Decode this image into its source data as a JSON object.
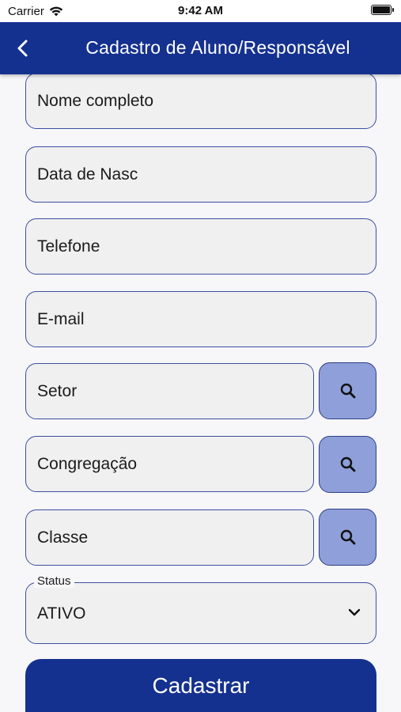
{
  "status_bar": {
    "carrier": "Carrier",
    "time": "9:42 AM"
  },
  "app_bar": {
    "title": "Cadastro de Aluno/Responsável",
    "color": "#15318f"
  },
  "form": {
    "nome_placeholder": "Nome completo",
    "data_nasc_placeholder": "Data de Nasc",
    "telefone_placeholder": "Telefone",
    "email_placeholder": "E-mail",
    "setor_placeholder": "Setor",
    "congregacao_placeholder": "Congregação",
    "classe_placeholder": "Classe",
    "status_label": "Status",
    "status_value": "ATIVO",
    "submit_label": "Cadastrar"
  },
  "icons": {
    "back": "chevron-left-icon",
    "search": "search-icon",
    "dropdown": "chevron-down-icon"
  },
  "colors": {
    "primary": "#15318f",
    "search_button": "#8e9fd9",
    "field_border": "#3c4fa0",
    "field_bg": "#f0f0f1"
  }
}
